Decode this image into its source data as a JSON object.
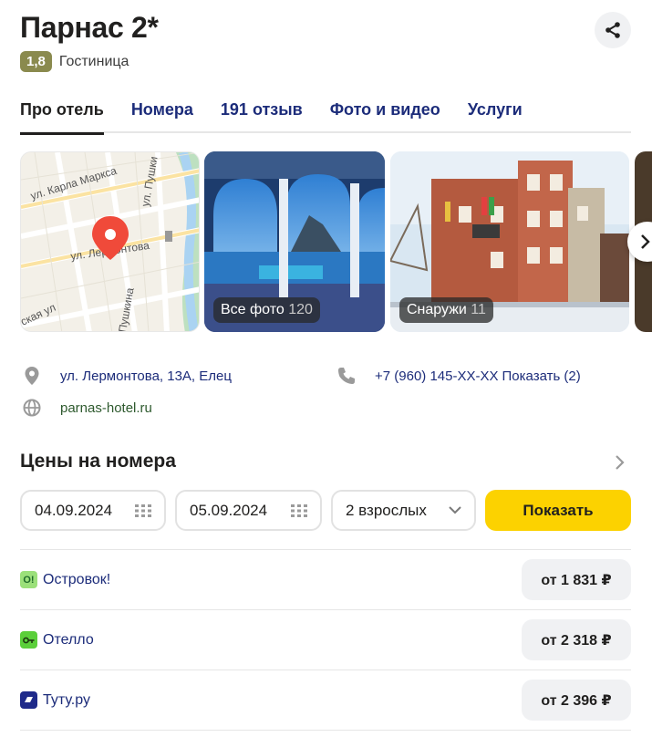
{
  "hotel": {
    "title": "Парнас 2*",
    "rating": "1,8",
    "category": "Гостиница"
  },
  "tabs": [
    {
      "label": "Про отель",
      "active": true
    },
    {
      "label": "Номера"
    },
    {
      "label": "191 отзыв"
    },
    {
      "label": "Фото и видео"
    },
    {
      "label": "Услуги"
    }
  ],
  "map": {
    "streets": [
      "ул. Карла Маркса",
      "ул. Пушки",
      "ул. Лермонтова",
      "ская ул",
      "Пушкина"
    ]
  },
  "gallery": {
    "all_photos_label": "Все фото",
    "all_photos_count": "120",
    "outside_label": "Снаружи",
    "outside_count": "11"
  },
  "contacts": {
    "address": "ул. Лермонтова, 13А, Елец",
    "phone": "+7 (960) 145-XX-XX",
    "phone_show": "Показать (2)",
    "website": "parnas-hotel.ru"
  },
  "prices": {
    "title": "Цены на номера",
    "checkin": "04.09.2024",
    "checkout": "05.09.2024",
    "guests": "2 взрослых",
    "show_button": "Показать"
  },
  "offers": [
    {
      "name": "Островок!",
      "price": "от 1 831 ₽",
      "logo_text": "O!",
      "logo_color": "#9be07a"
    },
    {
      "name": "Отелло",
      "price": "от 2 318 ₽",
      "logo_text": "",
      "logo_color": "#5bcf3a"
    },
    {
      "name": "Туту.ру",
      "price": "от 2 396 ₽",
      "logo_text": "",
      "logo_color": "#1f2a8a"
    }
  ],
  "colors": {
    "accent_yellow": "#fcd200",
    "link_blue": "#1c2c7a",
    "map_pin_red": "#f04a3a"
  }
}
